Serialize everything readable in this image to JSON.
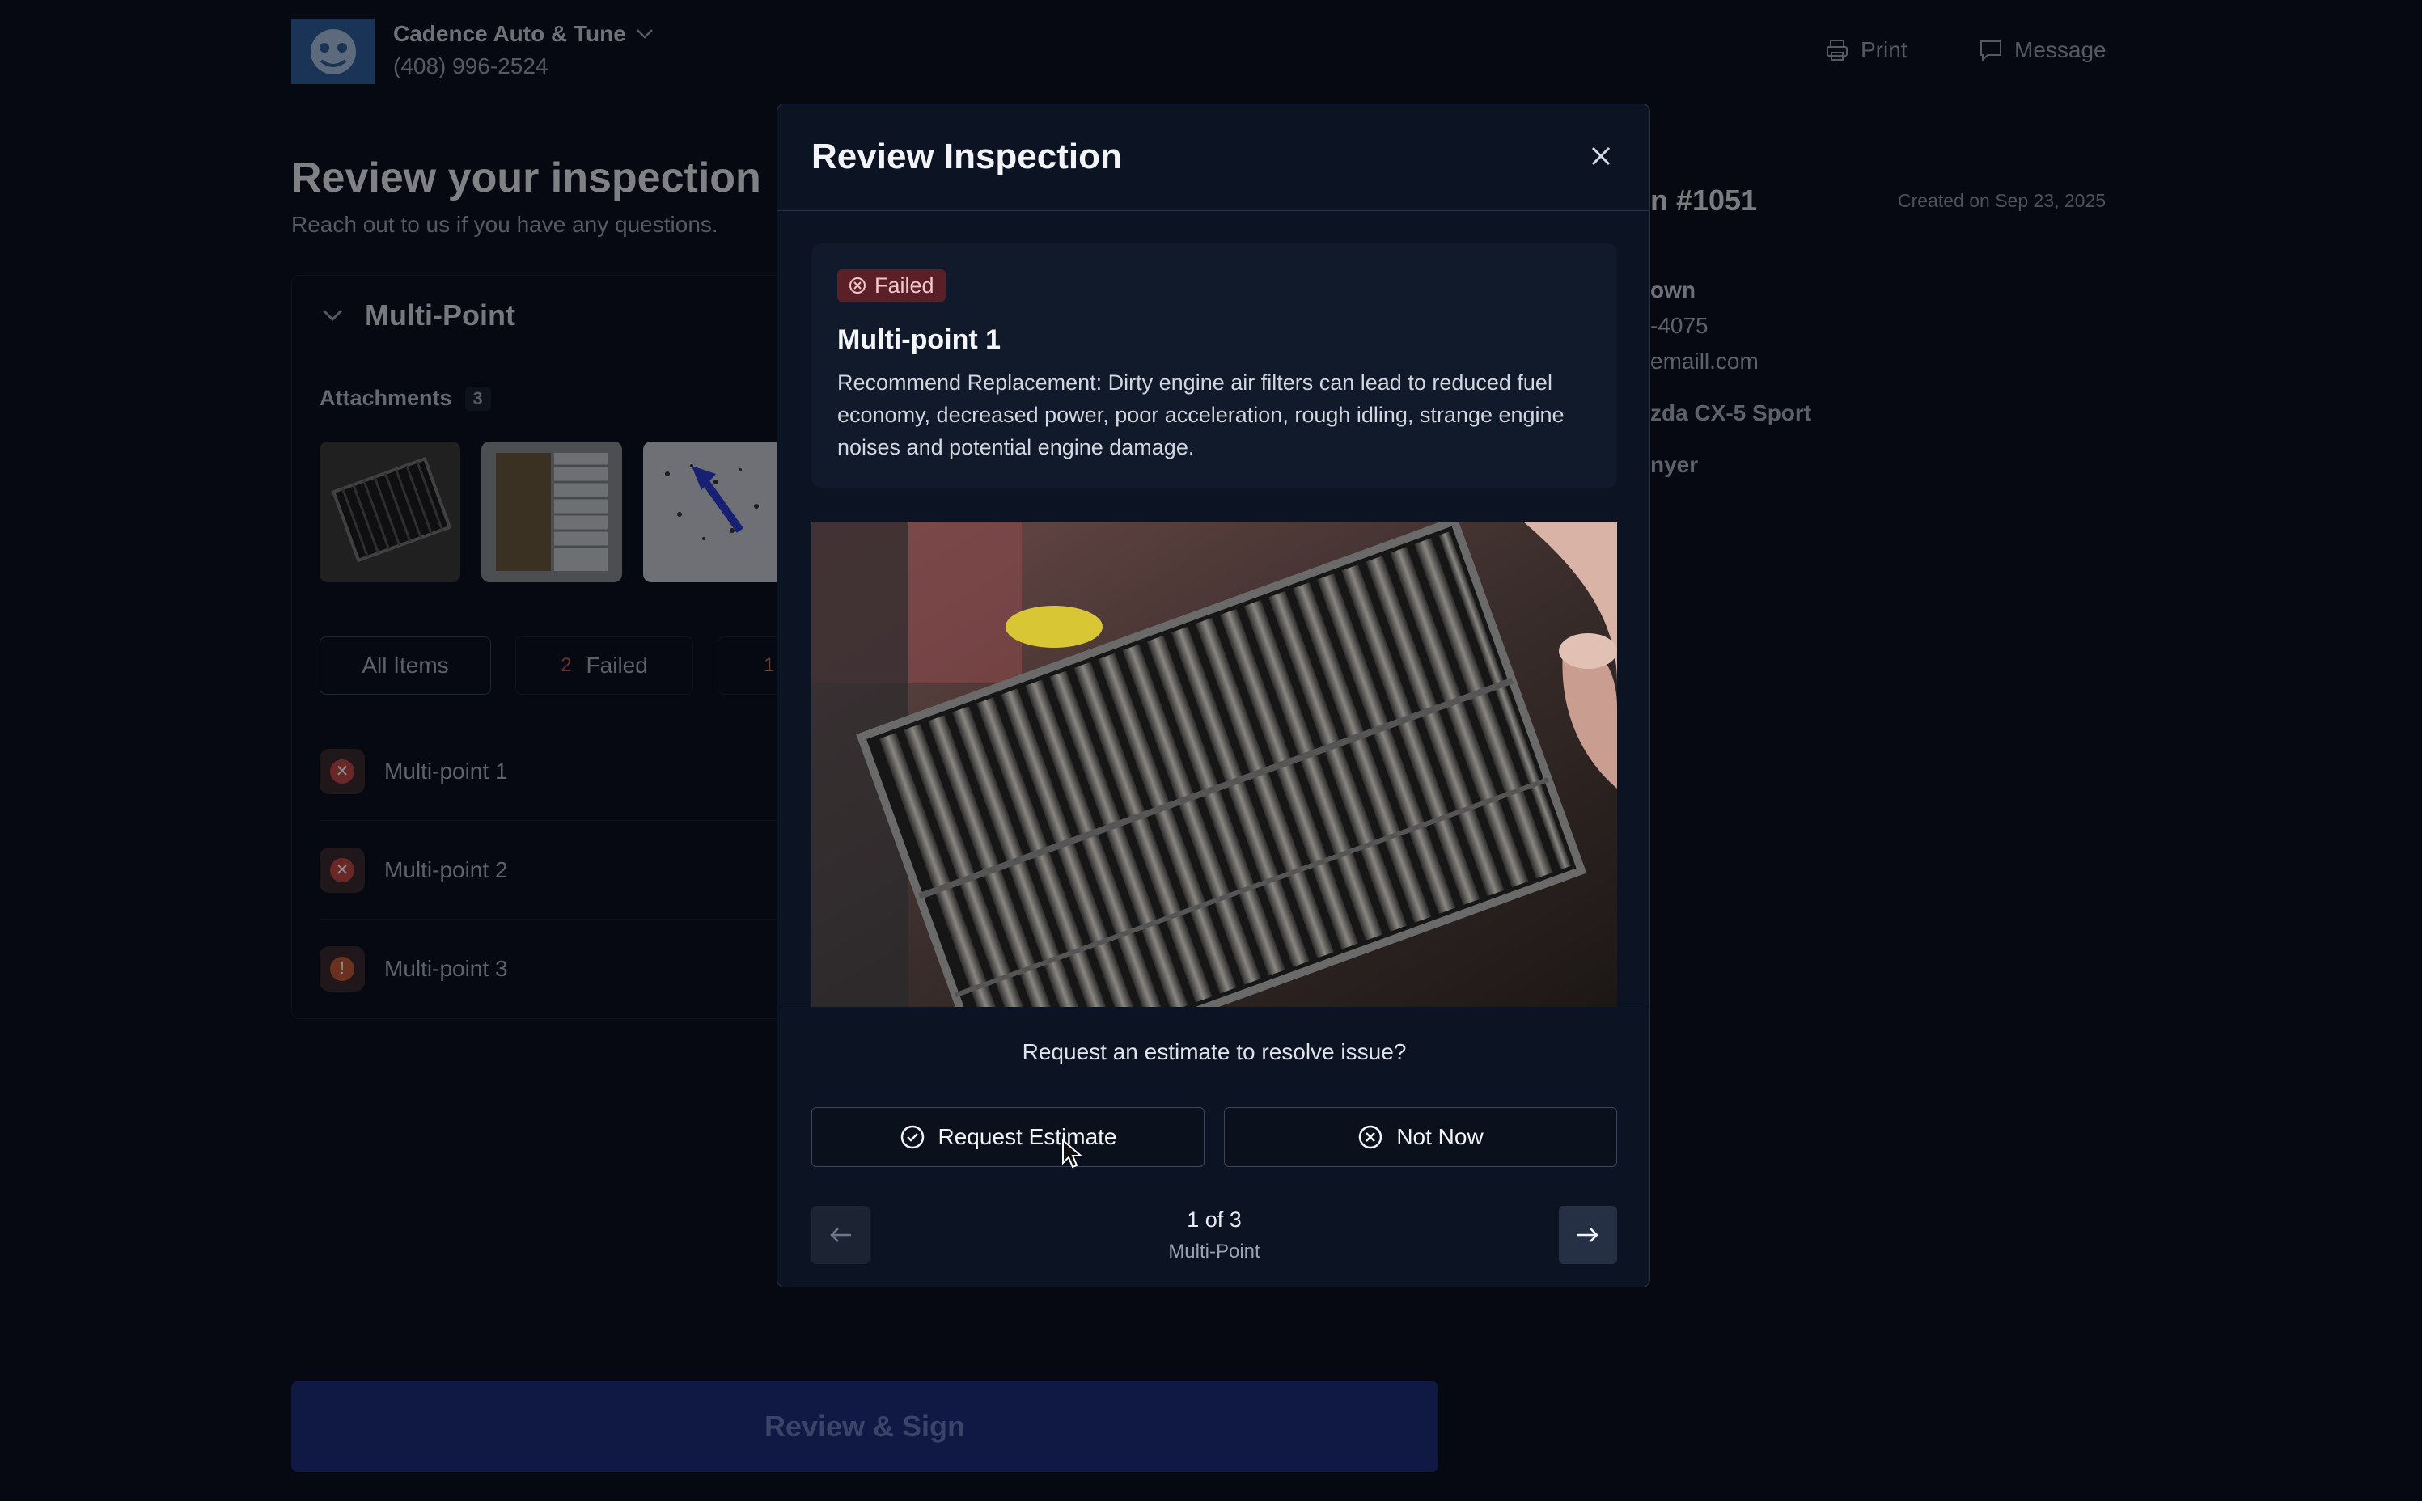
{
  "header": {
    "shop_name": "Cadence Auto & Tune",
    "shop_phone": "(408) 996-2524",
    "print_label": "Print",
    "message_label": "Message"
  },
  "main": {
    "title": "Review your inspection",
    "subtitle": "Reach out to us if you have any questions.",
    "section_title": "Multi-Point",
    "attachments_label": "Attachments",
    "attachments_count": "3",
    "filters": {
      "all_label": "All Items",
      "failed_count": "2",
      "failed_label": "Failed",
      "other_count": "1"
    },
    "items": [
      {
        "label": "Multi-point 1",
        "status": "failed"
      },
      {
        "label": "Multi-point 2",
        "status": "failed"
      },
      {
        "label": "Multi-point 3",
        "status": "warning"
      }
    ],
    "review_sign_label": "Review & Sign"
  },
  "side": {
    "order_fragment": "n #1051",
    "created": "Created on Sep 23, 2025",
    "name_fragment": "own",
    "phone_fragment": "-4075",
    "email_fragment": "emaill.com",
    "vehicle_fragment": "zda CX-5 Sport",
    "advisor_fragment": "nyer"
  },
  "modal": {
    "title": "Review Inspection",
    "badge_label": "Failed",
    "item_title": "Multi-point 1",
    "item_description": "Recommend Replacement: Dirty engine air filters can lead to reduced fuel economy, decreased power, poor acceleration, rough idling, strange engine noises and potential engine damage.",
    "question": "Request an estimate to resolve issue?",
    "request_label": "Request Estimate",
    "not_now_label": "Not Now",
    "pager_text": "1 of 3",
    "pager_section": "Multi-Point"
  },
  "colors": {
    "accent_blue": "#1c2f7c",
    "failed_red": "#c04848",
    "badge_bg": "#5a1f27"
  }
}
